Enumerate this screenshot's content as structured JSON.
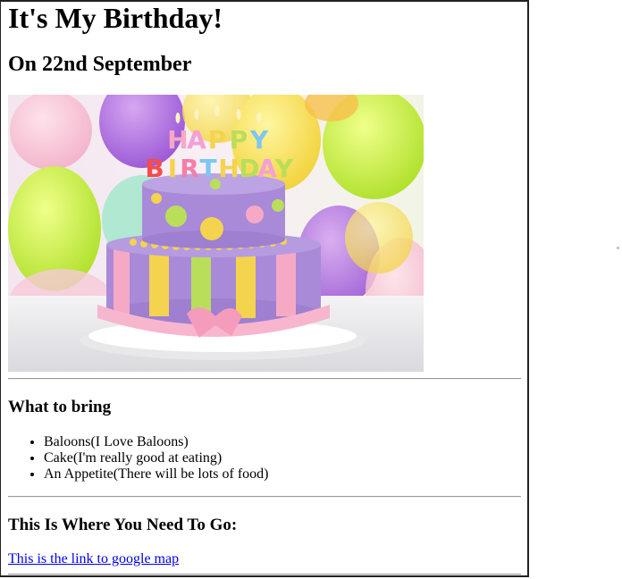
{
  "page": {
    "title": "It's My Birthday!",
    "subtitle": "On 22nd September"
  },
  "image": {
    "icon": "birthday-cake-photo",
    "candle_text_top": "HAPPY",
    "candle_text_bottom": "BIRTHDAY"
  },
  "bring": {
    "heading": "What to bring",
    "items": [
      "Baloons(I Love Baloons)",
      "Cake(I'm really good at eating)",
      "An Appetite(There will be lots of food)"
    ]
  },
  "location": {
    "heading": "This Is Where You Need To Go:",
    "link_text": "This is the link to google map"
  },
  "colors": {
    "link": "#0000ee",
    "text": "#000000",
    "rule": "#9a9a9a"
  }
}
